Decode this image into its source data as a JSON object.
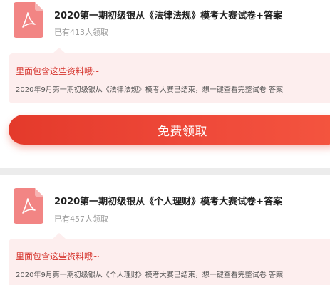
{
  "items": [
    {
      "title": "2020第一期初级银从《法律法规》模考大赛试卷+答案",
      "claimed_count": "已有413人领取",
      "info_heading": "里面包含这些资料哦~",
      "info_text": "2020年9月第一期初级银从《法律法规》模考大赛已结束，想一键查看完整试卷 答案",
      "button_label": "免费领取",
      "icon": "pdf-file-icon"
    },
    {
      "title": "2020第一期初级银从《个人理财》模考大赛试卷+答案",
      "claimed_count": "已有457人领取",
      "info_heading": "里面包含这些资料哦~",
      "info_text": "2020年9月第一期初级银从《个人理财》模考大赛已结束，想一键查看完整试卷 答案",
      "icon": "pdf-file-icon"
    }
  ],
  "colors": {
    "accent": "#e43a2b",
    "icon_bg": "#f28584",
    "info_bg": "#fdeeee",
    "info_heading": "#d6362f"
  }
}
